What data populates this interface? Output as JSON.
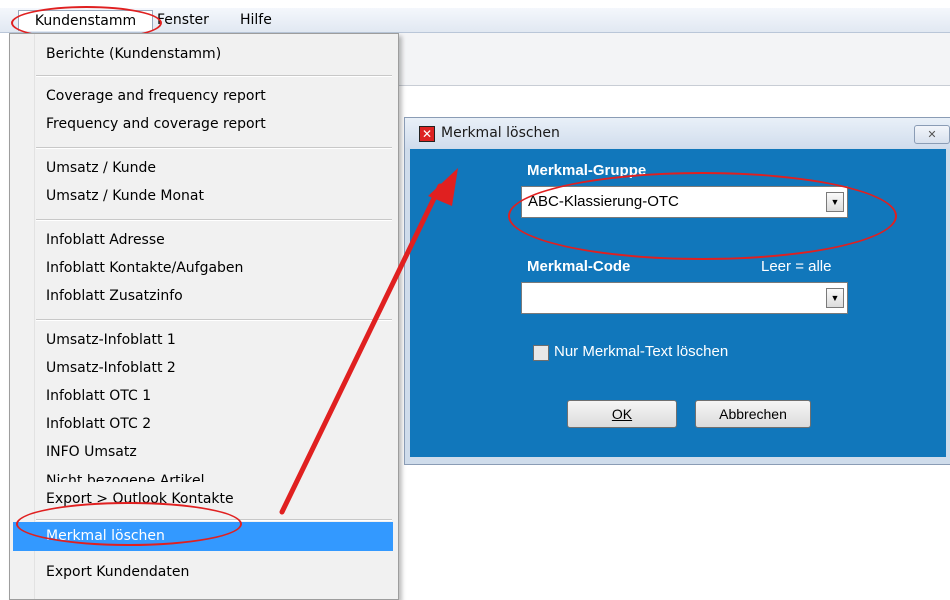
{
  "menubar": {
    "items": [
      "Kundenstamm",
      "Fenster",
      "Hilfe"
    ]
  },
  "dropdown": {
    "items": [
      "Berichte (Kundenstamm)",
      "Coverage and frequency report",
      "Frequency and coverage report",
      "Umsatz / Kunde",
      "Umsatz / Kunde Monat",
      "Infoblatt Adresse",
      "Infoblatt Kontakte/Aufgaben",
      "Infoblatt Zusatzinfo",
      "Umsatz-Infoblatt 1",
      "Umsatz-Infoblatt 2",
      "Infoblatt OTC 1",
      "Infoblatt OTC 2",
      "INFO Umsatz",
      "Nicht bezogene Artikel",
      "Export > Outlook Kontakte",
      "Merkmal löschen",
      "Export Kundendaten"
    ],
    "selected": "Merkmal löschen"
  },
  "dialog": {
    "title": "Merkmal löschen",
    "close_label": "✕",
    "group_label": "Merkmal-Gruppe",
    "group_value": "ABC-Klassierung-OTC",
    "code_label": "Merkmal-Code",
    "code_hint": "Leer = alle",
    "code_value": "",
    "checkbox_label": "Nur Merkmal-Text löschen",
    "ok_label": "OK",
    "cancel_label": "Abbrechen"
  },
  "colors": {
    "dialog_body": "#1177bb",
    "highlight": "#3399ff",
    "callout": "#e02020"
  },
  "icons": [
    "close-x-icon",
    "dropdown-arrow-icon",
    "checkbox-icon",
    "red-arrow-annotation"
  ]
}
